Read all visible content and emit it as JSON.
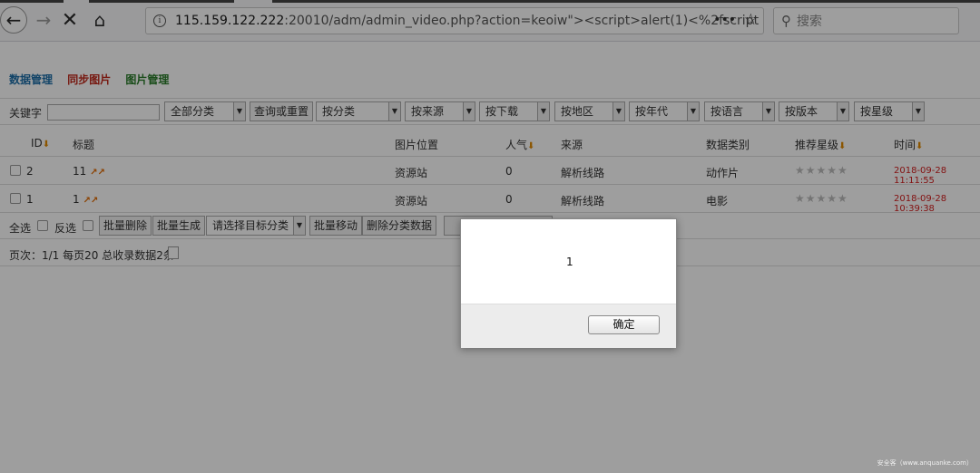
{
  "browser": {
    "url_host": "115.159.122.222",
    "url_rest": ":20010/adm/admin_video.php?action=keoiw\"><script>alert(1)<%2fscript",
    "search_placeholder": "搜索",
    "dots": "•••"
  },
  "nav": {
    "items": [
      "数据管理",
      "同步图片",
      "图片管理"
    ]
  },
  "filters": {
    "keyword_label": "关键字",
    "category_select": "全部分类",
    "query_button": "查询或重置",
    "selects": [
      "按分类",
      "按来源",
      "按下载",
      "按地区",
      "按年代",
      "按语言",
      "按版本",
      "按星级"
    ]
  },
  "table": {
    "headers": {
      "id": "ID",
      "title": "标题",
      "location": "图片位置",
      "popularity": "人气",
      "source": "来源",
      "category": "数据类别",
      "rating": "推荐星级",
      "time": "时间"
    },
    "sort_glyph": "⬇",
    "rows": [
      {
        "id": "2",
        "title": "11",
        "location": "资源站",
        "popularity": "0",
        "source": "解析线路",
        "category": "动作片",
        "stars": "★★★★★",
        "time": "2018-09-28 11:11:55"
      },
      {
        "id": "1",
        "title": "1",
        "location": "资源站",
        "popularity": "0",
        "source": "解析线路",
        "category": "电影",
        "stars": "★★★★★",
        "time": "2018-09-28 10:39:38"
      }
    ]
  },
  "actions": {
    "select_all": "全选",
    "invert": "反选",
    "batch_delete": "批量删除",
    "batch_generate": "批量生成",
    "target_category": "请选择目标分类",
    "batch_move": "批量移动",
    "delete_category_data": "删除分类数据"
  },
  "pager": {
    "text": "页次：1/1 每页20 总收录数据2条"
  },
  "alert": {
    "message": "1",
    "ok_label": "确定"
  },
  "watermark": "安全客（www.anquanke.com）"
}
